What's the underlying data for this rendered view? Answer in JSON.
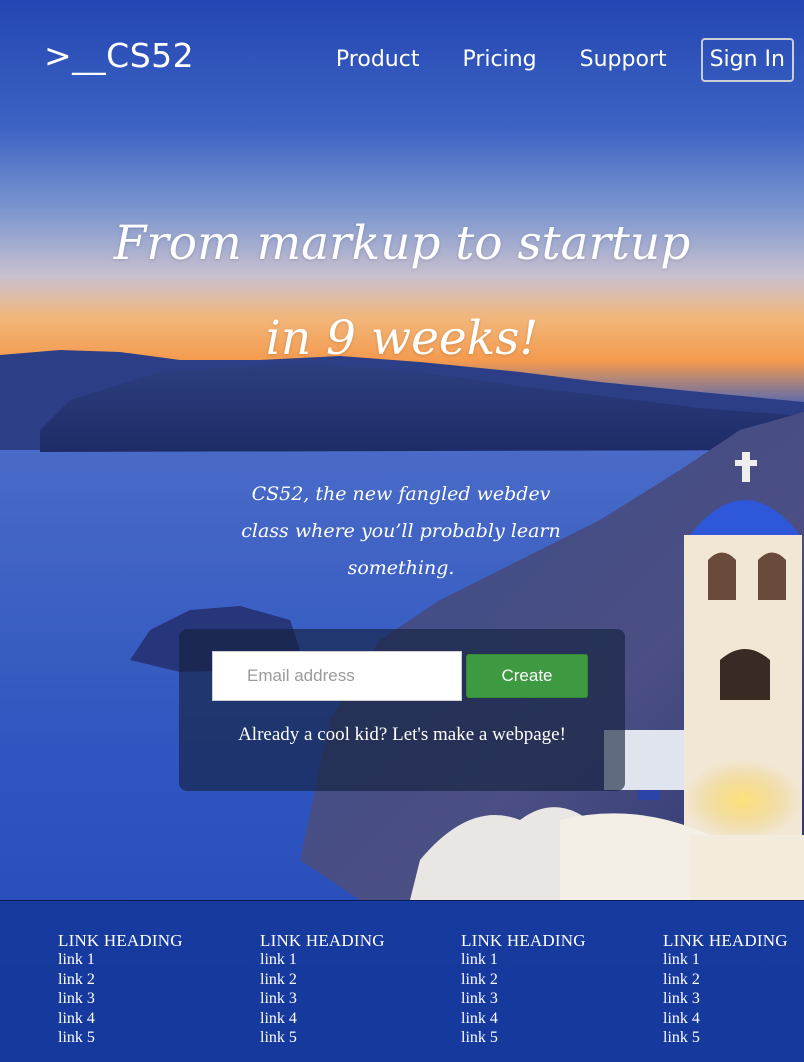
{
  "header": {
    "logo": ">__CS52",
    "nav": [
      "Product",
      "Pricing",
      "Support"
    ],
    "sign_in": "Sign In"
  },
  "hero": {
    "title_line1": "From markup to startup",
    "title_line2": "in 9 weeks!",
    "tagline_line1": "CS52, the new fangled webdev",
    "tagline_line2": "class where you’ll probably learn",
    "tagline_line3": "something."
  },
  "signup": {
    "email_placeholder": "Email address",
    "email_value": "",
    "create_label": "Create",
    "cool_kid_text": "Already a cool kid? Let's make a webpage!"
  },
  "footer": {
    "columns": [
      {
        "heading": "LINK HEADING",
        "links": [
          "link 1",
          "link 2",
          "link 3",
          "link 4",
          "link 5"
        ]
      },
      {
        "heading": "LINK HEADING",
        "links": [
          "link 1",
          "link 2",
          "link 3",
          "link 4",
          "link 5"
        ]
      },
      {
        "heading": "LINK HEADING",
        "links": [
          "link 1",
          "link 2",
          "link 3",
          "link 4",
          "link 5"
        ]
      },
      {
        "heading": "LINK HEADING",
        "links": [
          "link 1",
          "link 2",
          "link 3",
          "link 4",
          "link 5"
        ]
      }
    ]
  },
  "colors": {
    "sky_top": "#2a4fb8",
    "sunset": "#f6a85a",
    "sea": "#2c4fb0",
    "create_button": "#3d9a40",
    "footer": "#12349a"
  }
}
